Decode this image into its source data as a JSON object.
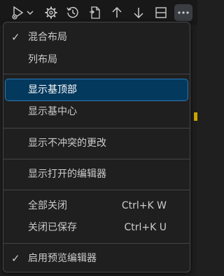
{
  "toolbar": {
    "icons": [
      {
        "name": "run-debug-icon"
      },
      {
        "name": "chevron-down-icon"
      },
      {
        "name": "gear-icon"
      },
      {
        "name": "history-icon"
      },
      {
        "name": "open-file-icon"
      },
      {
        "name": "arrow-up-icon"
      },
      {
        "name": "arrow-down-icon"
      },
      {
        "name": "split-layout-icon"
      },
      {
        "name": "more-actions-icon"
      }
    ]
  },
  "menu": {
    "items": [
      {
        "label": "混合布局",
        "checked": true
      },
      {
        "label": "列布局",
        "checked": false
      },
      {
        "label": "显示基顶部",
        "selected": true
      },
      {
        "label": "显示基中心"
      },
      {
        "label": "显示不冲突的更改"
      },
      {
        "label": "显示打开的编辑器"
      },
      {
        "label": "全部关闭",
        "shortcut": "Ctrl+K W"
      },
      {
        "label": "关闭已保存",
        "shortcut": "Ctrl+K U"
      },
      {
        "label": "启用预览编辑器",
        "checked": true
      }
    ],
    "check_glyph": "✓"
  },
  "colors": {
    "menu_bg": "#1f1f1f",
    "selected_bg": "#04395e",
    "selected_border": "#2b79b6",
    "text": "#cccccc",
    "separator": "#454545",
    "accent": "#cca700"
  }
}
